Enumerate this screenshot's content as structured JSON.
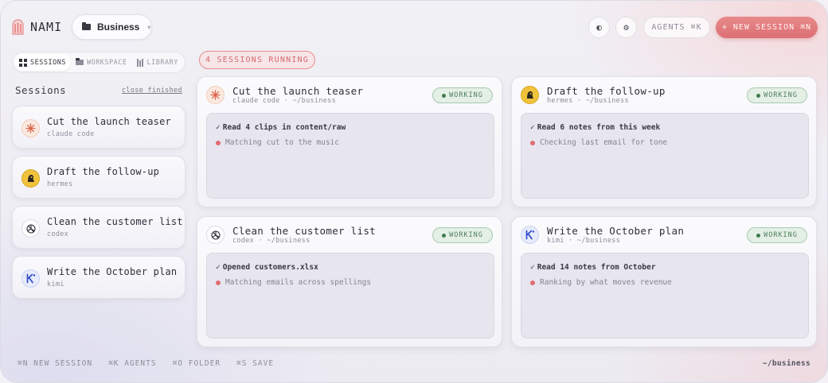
{
  "header": {
    "app_name": "NAMI",
    "workspace": "Business",
    "agents_label": "AGENTS ⌘K",
    "new_session_label": "+ NEW SESSION ⌘N"
  },
  "tabs": [
    {
      "label": "SESSIONS",
      "icon": "grid-icon",
      "active": true
    },
    {
      "label": "WORKSPACE",
      "icon": "folder-icon",
      "active": false
    },
    {
      "label": "LIBRARY",
      "icon": "library-icon",
      "active": false
    }
  ],
  "running_badge": "4 SESSIONS RUNNING",
  "sidebar": {
    "title": "Sessions",
    "close_finished": "close finished",
    "items": [
      {
        "title": "Cut the launch teaser",
        "agent": "claude code",
        "icon": "claude-icon"
      },
      {
        "title": "Draft the follow-up",
        "agent": "hermes",
        "icon": "hermes-icon"
      },
      {
        "title": "Clean the customer list",
        "agent": "codex",
        "icon": "codex-icon"
      },
      {
        "title": "Write the October plan",
        "agent": "kimi",
        "icon": "kimi-icon"
      }
    ]
  },
  "cards": [
    {
      "title": "Cut the launch teaser",
      "subtitle": "claude code · ~/business",
      "status": "WORKING",
      "done": "Read 4 clips in content/raw",
      "current": "Matching cut to the music"
    },
    {
      "title": "Draft the follow-up",
      "subtitle": "hermes · ~/business",
      "status": "WORKING",
      "done": "Read 6 notes from this week",
      "current": "Checking last email for tone"
    },
    {
      "title": "Clean the customer list",
      "subtitle": "codex · ~/business",
      "status": "WORKING",
      "done": "Opened customers.xlsx",
      "current": "Matching emails across spellings"
    },
    {
      "title": "Write the October plan",
      "subtitle": "kimi · ~/business",
      "status": "WORKING",
      "done": "Read 14 notes from October",
      "current": "Ranking by what moves revenue"
    }
  ],
  "footer": {
    "shortcuts": [
      "⌘N NEW SESSION",
      "⌘K AGENTS",
      "⌘O FOLDER",
      "⌘S SAVE"
    ],
    "cwd": "~/business"
  },
  "colors": {
    "accent": "#dc6f73",
    "working_green": "#4e7f5c",
    "progress_dot": "#e06c70"
  }
}
